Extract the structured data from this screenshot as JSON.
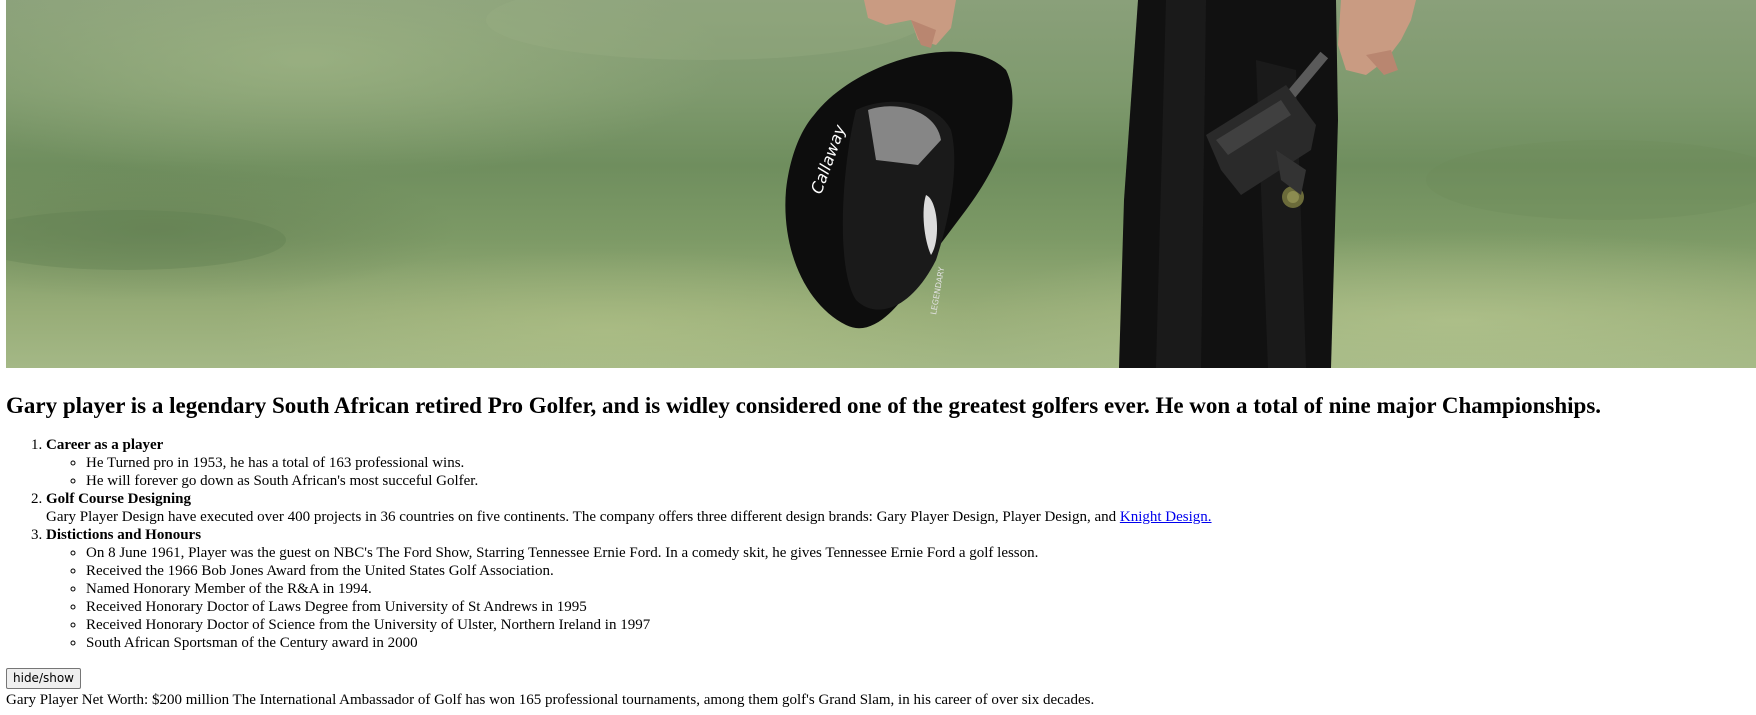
{
  "hero": {
    "image_label": "Gary Player holding a Callaway cap and a putter on the green",
    "cap_text": "Callaway",
    "cap_band_text": "LEGENDARY"
  },
  "heading": "Gary player is a legendary South African retired Pro Golfer, and is widley considered one of the greatest golfers ever. He won a total of nine major Championships.",
  "sections": [
    {
      "title": "Career as a player",
      "bullets": [
        "He Turned pro in 1953, he has a total of 163 professional wins.",
        "He will forever go down as South African's most succeful Golfer."
      ]
    },
    {
      "title": "Golf Course Designing",
      "description": "Gary Player Design have executed over 400 projects in 36 countries on five continents. The company offers three different design brands: Gary Player Design, Player Design, and",
      "link_text": "Knight Design."
    },
    {
      "title": "Distictions and Honours",
      "bullets": [
        "On 8 June 1961, Player was the guest on NBC's The Ford Show, Starring Tennessee Ernie Ford. In a comedy skit, he gives Tennessee Ernie Ford a golf lesson.",
        "Received the 1966 Bob Jones Award from the United States Golf Association.",
        "Named Honorary Member of the R&A in 1994.",
        "Received Honorary Doctor of Laws Degree from University of St Andrews in 1995",
        "Received Honorary Doctor of Science from the University of Ulster, Northern Ireland in 1997",
        "South African Sportsman of the Century award in 2000"
      ]
    }
  ],
  "toggle_button": "hide/show",
  "net_worth_text": "Gary Player Net Worth: $200 million The International Ambassador of Golf has won 165 professional tournaments, among them golf's Grand Slam, in his career of over six decades.",
  "colors": {
    "link": "#0000ee",
    "grass": "#7f9a6e",
    "background": "#ffffff"
  }
}
